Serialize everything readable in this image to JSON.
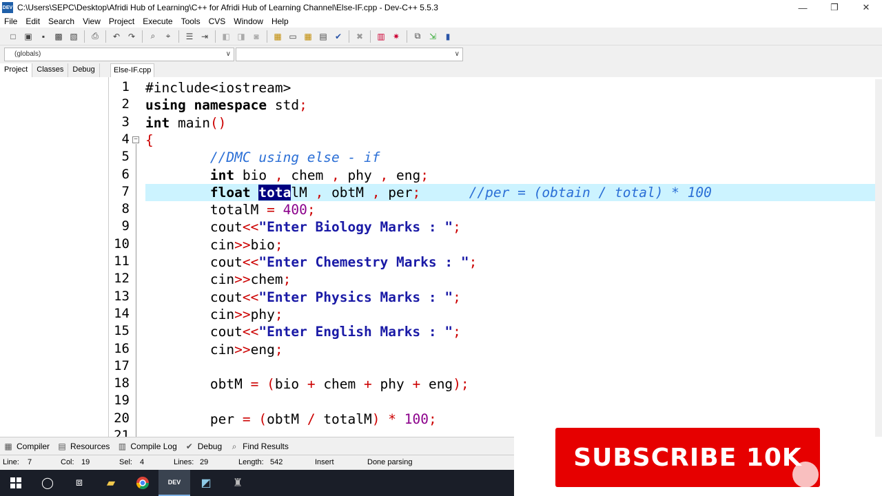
{
  "window": {
    "app_icon_label": "DEV",
    "title": "C:\\Users\\SEPC\\Desktop\\Afridi Hub of Learning\\C++ for Afridi Hub of Learning Channel\\Else-IF.cpp - Dev-C++ 5.5.3",
    "minimize": "—",
    "maximize": "❐",
    "close": "✕"
  },
  "menu": [
    "File",
    "Edit",
    "Search",
    "View",
    "Project",
    "Execute",
    "Tools",
    "CVS",
    "Window",
    "Help"
  ],
  "combos": {
    "scope": "(globals)",
    "member": ""
  },
  "left_tabs": [
    "Project",
    "Classes",
    "Debug"
  ],
  "file_tab": "Else-IF.cpp",
  "editor": {
    "line_numbers": [
      "1",
      "2",
      "3",
      "4",
      "5",
      "6",
      "7",
      "8",
      "9",
      "10",
      "11",
      "12",
      "13",
      "14",
      "15",
      "16",
      "17",
      "18",
      "19",
      "20",
      "21"
    ],
    "fold_marker": "−",
    "active_line": 7,
    "lines": [
      [
        {
          "t": "#include<iostream>",
          "c": "p"
        }
      ],
      [
        {
          "t": "using namespace ",
          "c": "k"
        },
        {
          "t": "std",
          "c": "p"
        },
        {
          "t": ";",
          "c": "o"
        }
      ],
      [
        {
          "t": "int ",
          "c": "k"
        },
        {
          "t": "main",
          "c": "p"
        },
        {
          "t": "()",
          "c": "o"
        }
      ],
      [
        {
          "t": "{",
          "c": "o"
        }
      ],
      [
        {
          "t": "        ",
          "c": "p"
        },
        {
          "t": "//DMC using else - if",
          "c": "c"
        }
      ],
      [
        {
          "t": "        ",
          "c": "p"
        },
        {
          "t": "int ",
          "c": "k"
        },
        {
          "t": "bio ",
          "c": "p"
        },
        {
          "t": ", ",
          "c": "o"
        },
        {
          "t": "chem ",
          "c": "p"
        },
        {
          "t": ", ",
          "c": "o"
        },
        {
          "t": "phy ",
          "c": "p"
        },
        {
          "t": ", ",
          "c": "o"
        },
        {
          "t": "eng",
          "c": "p"
        },
        {
          "t": ";",
          "c": "o"
        }
      ],
      [
        {
          "t": "        ",
          "c": "p"
        },
        {
          "t": "float ",
          "c": "k"
        },
        {
          "t": "tota",
          "c": "sel"
        },
        {
          "t": "lM ",
          "c": "p"
        },
        {
          "t": ", ",
          "c": "o"
        },
        {
          "t": "obtM ",
          "c": "p"
        },
        {
          "t": ", ",
          "c": "o"
        },
        {
          "t": "per",
          "c": "p"
        },
        {
          "t": ";",
          "c": "o"
        },
        {
          "t": "      ",
          "c": "p"
        },
        {
          "t": "//per = (obtain / total) * 100",
          "c": "c"
        }
      ],
      [
        {
          "t": "        ",
          "c": "p"
        },
        {
          "t": "totalM ",
          "c": "p"
        },
        {
          "t": "= ",
          "c": "o"
        },
        {
          "t": "400",
          "c": "n"
        },
        {
          "t": ";",
          "c": "o"
        }
      ],
      [
        {
          "t": "        ",
          "c": "p"
        },
        {
          "t": "cout",
          "c": "p"
        },
        {
          "t": "<<",
          "c": "o"
        },
        {
          "t": "\"Enter Biology Marks : \"",
          "c": "s"
        },
        {
          "t": ";",
          "c": "o"
        }
      ],
      [
        {
          "t": "        ",
          "c": "p"
        },
        {
          "t": "cin",
          "c": "p"
        },
        {
          "t": ">>",
          "c": "o"
        },
        {
          "t": "bio",
          "c": "p"
        },
        {
          "t": ";",
          "c": "o"
        }
      ],
      [
        {
          "t": "        ",
          "c": "p"
        },
        {
          "t": "cout",
          "c": "p"
        },
        {
          "t": "<<",
          "c": "o"
        },
        {
          "t": "\"Enter Chemestry Marks : \"",
          "c": "s"
        },
        {
          "t": ";",
          "c": "o"
        }
      ],
      [
        {
          "t": "        ",
          "c": "p"
        },
        {
          "t": "cin",
          "c": "p"
        },
        {
          "t": ">>",
          "c": "o"
        },
        {
          "t": "chem",
          "c": "p"
        },
        {
          "t": ";",
          "c": "o"
        }
      ],
      [
        {
          "t": "        ",
          "c": "p"
        },
        {
          "t": "cout",
          "c": "p"
        },
        {
          "t": "<<",
          "c": "o"
        },
        {
          "t": "\"Enter Physics Marks : \"",
          "c": "s"
        },
        {
          "t": ";",
          "c": "o"
        }
      ],
      [
        {
          "t": "        ",
          "c": "p"
        },
        {
          "t": "cin",
          "c": "p"
        },
        {
          "t": ">>",
          "c": "o"
        },
        {
          "t": "phy",
          "c": "p"
        },
        {
          "t": ";",
          "c": "o"
        }
      ],
      [
        {
          "t": "        ",
          "c": "p"
        },
        {
          "t": "cout",
          "c": "p"
        },
        {
          "t": "<<",
          "c": "o"
        },
        {
          "t": "\"Enter English Marks : \"",
          "c": "s"
        },
        {
          "t": ";",
          "c": "o"
        }
      ],
      [
        {
          "t": "        ",
          "c": "p"
        },
        {
          "t": "cin",
          "c": "p"
        },
        {
          "t": ">>",
          "c": "o"
        },
        {
          "t": "eng",
          "c": "p"
        },
        {
          "t": ";",
          "c": "o"
        }
      ],
      [],
      [
        {
          "t": "        ",
          "c": "p"
        },
        {
          "t": "obtM ",
          "c": "p"
        },
        {
          "t": "= ",
          "c": "o"
        },
        {
          "t": "(",
          "c": "o"
        },
        {
          "t": "bio ",
          "c": "p"
        },
        {
          "t": "+ ",
          "c": "o"
        },
        {
          "t": "chem ",
          "c": "p"
        },
        {
          "t": "+ ",
          "c": "o"
        },
        {
          "t": "phy ",
          "c": "p"
        },
        {
          "t": "+ ",
          "c": "o"
        },
        {
          "t": "eng",
          "c": "p"
        },
        {
          "t": ");",
          "c": "o"
        }
      ],
      [],
      [
        {
          "t": "        ",
          "c": "p"
        },
        {
          "t": "per ",
          "c": "p"
        },
        {
          "t": "= ",
          "c": "o"
        },
        {
          "t": "(",
          "c": "o"
        },
        {
          "t": "obtM ",
          "c": "p"
        },
        {
          "t": "/ ",
          "c": "o"
        },
        {
          "t": "totalM",
          "c": "p"
        },
        {
          "t": ") * ",
          "c": "o"
        },
        {
          "t": "100",
          "c": "n"
        },
        {
          "t": ";",
          "c": "o"
        }
      ],
      []
    ]
  },
  "bottom_tabs": [
    {
      "icon": "compiler-icon",
      "glyph": "▦",
      "label": "Compiler"
    },
    {
      "icon": "resources-icon",
      "glyph": "▤",
      "label": "Resources"
    },
    {
      "icon": "compile-log-icon",
      "glyph": "▥",
      "label": "Compile Log"
    },
    {
      "icon": "debug-icon",
      "glyph": "✔",
      "label": "Debug"
    },
    {
      "icon": "find-results-icon",
      "glyph": "⌕",
      "label": "Find Results"
    }
  ],
  "status": {
    "line_label": "Line:",
    "line_value": "7",
    "col_label": "Col:",
    "col_value": "19",
    "sel_label": "Sel:",
    "sel_value": "4",
    "lines_label": "Lines:",
    "lines_value": "29",
    "length_label": "Length:",
    "length_value": "542",
    "mode": "Insert",
    "message": "Done parsing"
  },
  "overlay": {
    "subscribe": "SUBSCRIBE 10K"
  },
  "colors": {
    "active_line_bg": "#ccf3ff",
    "subscribe_red": "#e60000",
    "taskbar": "#1a1e28"
  }
}
